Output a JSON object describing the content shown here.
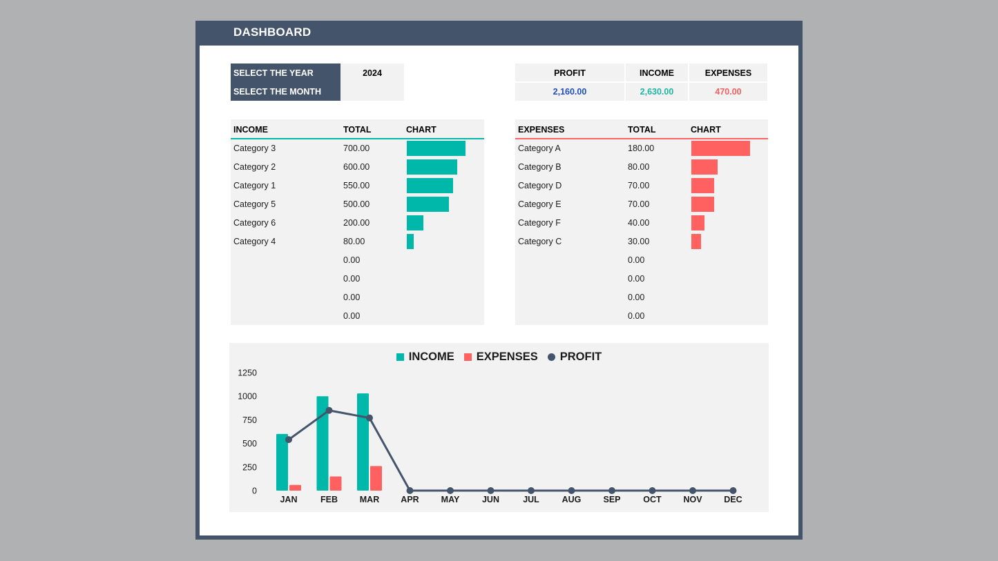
{
  "app": {
    "title": "DASHBOARD"
  },
  "colors": {
    "frame": "#44546a",
    "panel": "#f2f2f2",
    "income": "#00b8a9",
    "expenses": "#ff6161",
    "profit_line": "#44546a",
    "profit_value": "#1f4fb8",
    "income_value": "#1fb5a3",
    "expenses_value": "#f26060"
  },
  "selectors": {
    "year_label": "SELECT THE YEAR",
    "year_value": "2024",
    "month_label": "SELECT THE MONTH",
    "month_value": ""
  },
  "summary": {
    "headers": [
      "PROFIT",
      "INCOME",
      "EXPENSES"
    ],
    "values": [
      "2,160.00",
      "2,630.00",
      "470.00"
    ]
  },
  "income_table": {
    "headers": [
      "INCOME",
      "TOTAL",
      "CHART"
    ],
    "max_value": 700,
    "rows": [
      {
        "category": "Category 3",
        "total": "700.00",
        "value": 700
      },
      {
        "category": "Category 2",
        "total": "600.00",
        "value": 600
      },
      {
        "category": "Category 1",
        "total": "550.00",
        "value": 550
      },
      {
        "category": "Category 5",
        "total": "500.00",
        "value": 500
      },
      {
        "category": "Category 6",
        "total": "200.00",
        "value": 200
      },
      {
        "category": "Category 4",
        "total": "80.00",
        "value": 80
      },
      {
        "category": "",
        "total": "0.00",
        "value": 0
      },
      {
        "category": "",
        "total": "0.00",
        "value": 0
      },
      {
        "category": "",
        "total": "0.00",
        "value": 0
      },
      {
        "category": "",
        "total": "0.00",
        "value": 0
      }
    ]
  },
  "expenses_table": {
    "headers": [
      "EXPENSES",
      "TOTAL",
      "CHART"
    ],
    "max_value": 180,
    "rows": [
      {
        "category": "Category A",
        "total": "180.00",
        "value": 180
      },
      {
        "category": "Category B",
        "total": "80.00",
        "value": 80
      },
      {
        "category": "Category D",
        "total": "70.00",
        "value": 70
      },
      {
        "category": "Category E",
        "total": "70.00",
        "value": 70
      },
      {
        "category": "Category F",
        "total": "40.00",
        "value": 40
      },
      {
        "category": "Category C",
        "total": "30.00",
        "value": 30
      },
      {
        "category": "",
        "total": "0.00",
        "value": 0
      },
      {
        "category": "",
        "total": "0.00",
        "value": 0
      },
      {
        "category": "",
        "total": "0.00",
        "value": 0
      },
      {
        "category": "",
        "total": "0.00",
        "value": 0
      }
    ]
  },
  "chart_data": {
    "type": "bar",
    "title": "",
    "xlabel": "",
    "ylabel": "",
    "categories": [
      "JAN",
      "FEB",
      "MAR",
      "APR",
      "MAY",
      "JUN",
      "JUL",
      "AUG",
      "SEP",
      "OCT",
      "NOV",
      "DEC"
    ],
    "series": [
      {
        "name": "INCOME",
        "type": "bar",
        "values": [
          600,
          1000,
          1030,
          0,
          0,
          0,
          0,
          0,
          0,
          0,
          0,
          0
        ]
      },
      {
        "name": "EXPENSES",
        "type": "bar",
        "values": [
          60,
          150,
          260,
          0,
          0,
          0,
          0,
          0,
          0,
          0,
          0,
          0
        ]
      },
      {
        "name": "PROFIT",
        "type": "line",
        "values": [
          540,
          850,
          770,
          0,
          0,
          0,
          0,
          0,
          0,
          0,
          0,
          0
        ]
      }
    ],
    "ylim": [
      0,
      1250
    ],
    "yticks": [
      0,
      250,
      500,
      750,
      1000,
      1250
    ],
    "grid": false,
    "legend": "top-center"
  }
}
